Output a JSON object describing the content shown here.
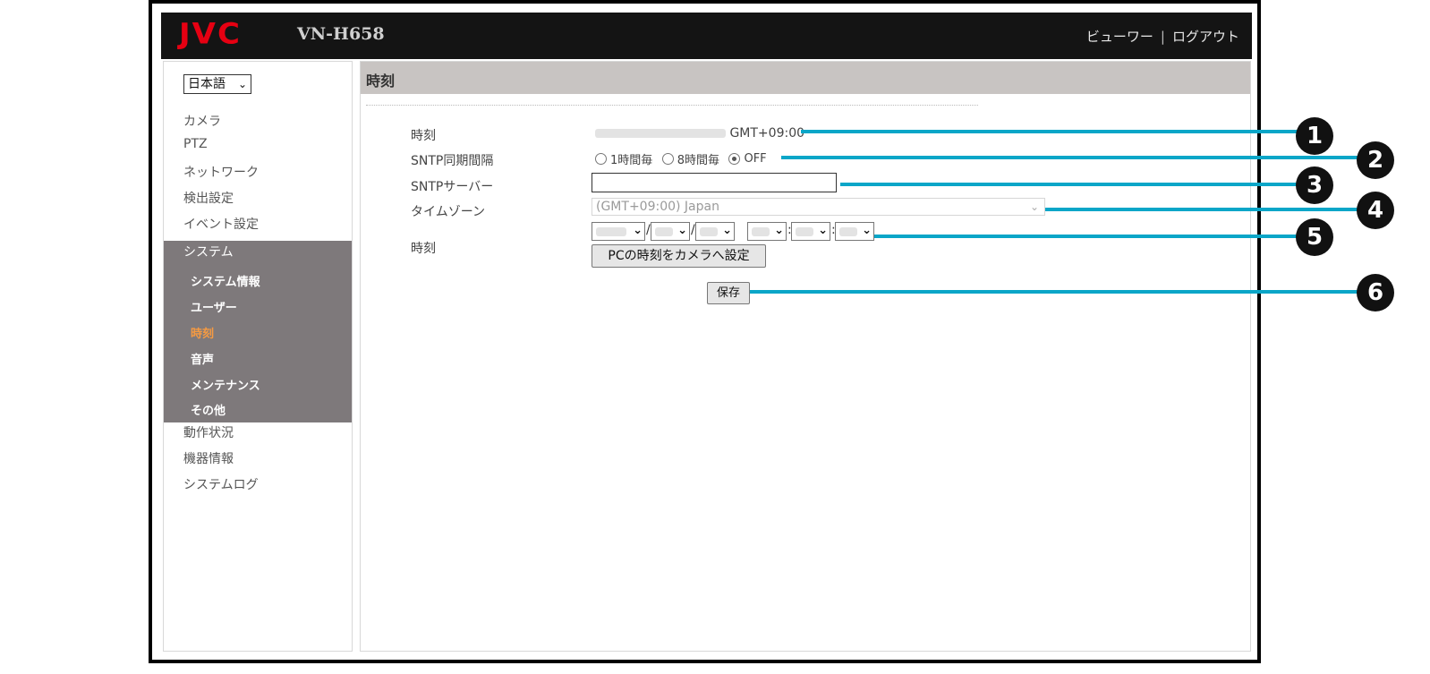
{
  "header": {
    "logo_text": "JVC",
    "model": "VN-H658",
    "viewer_link": "ビューワー",
    "separator": "|",
    "logout_link": "ログアウト"
  },
  "sidebar": {
    "language_select": "日本語",
    "items": [
      "カメラ",
      "PTZ",
      "ネットワーク",
      "検出設定",
      "イベント設定"
    ],
    "system_label": "システム",
    "system_subitems": [
      "システム情報",
      "ユーザー",
      "時刻",
      "音声",
      "メンテナンス",
      "その他"
    ],
    "active_subitem": "時刻",
    "items_after": [
      "動作状況",
      "機器情報",
      "システムログ"
    ]
  },
  "content": {
    "title": "時刻",
    "rows": {
      "time_label": "時刻",
      "time_suffix": "GMT+09:00",
      "sntp_interval_label": "SNTP同期間隔",
      "sntp_options": [
        "1時間毎",
        "8時間毎",
        "OFF"
      ],
      "sntp_selected": "OFF",
      "sntp_server_label": "SNTPサーバー",
      "sntp_server_value": "",
      "timezone_label": "タイムゾーン",
      "timezone_value": "(GMT+09:00) Japan",
      "datetime_label": "時刻",
      "date_sep": "/",
      "time_sep": ":",
      "pc_time_button": "PCの時刻をカメラへ設定",
      "save_button": "保存"
    }
  },
  "callouts": [
    "1",
    "2",
    "3",
    "4",
    "5",
    "6"
  ],
  "colors": {
    "header_bg": "#141414",
    "logo_red": "#e60012",
    "active_orange": "#f59a42",
    "system_block_bg": "#7e797b",
    "callout_cyan": "#0aa6c8"
  }
}
